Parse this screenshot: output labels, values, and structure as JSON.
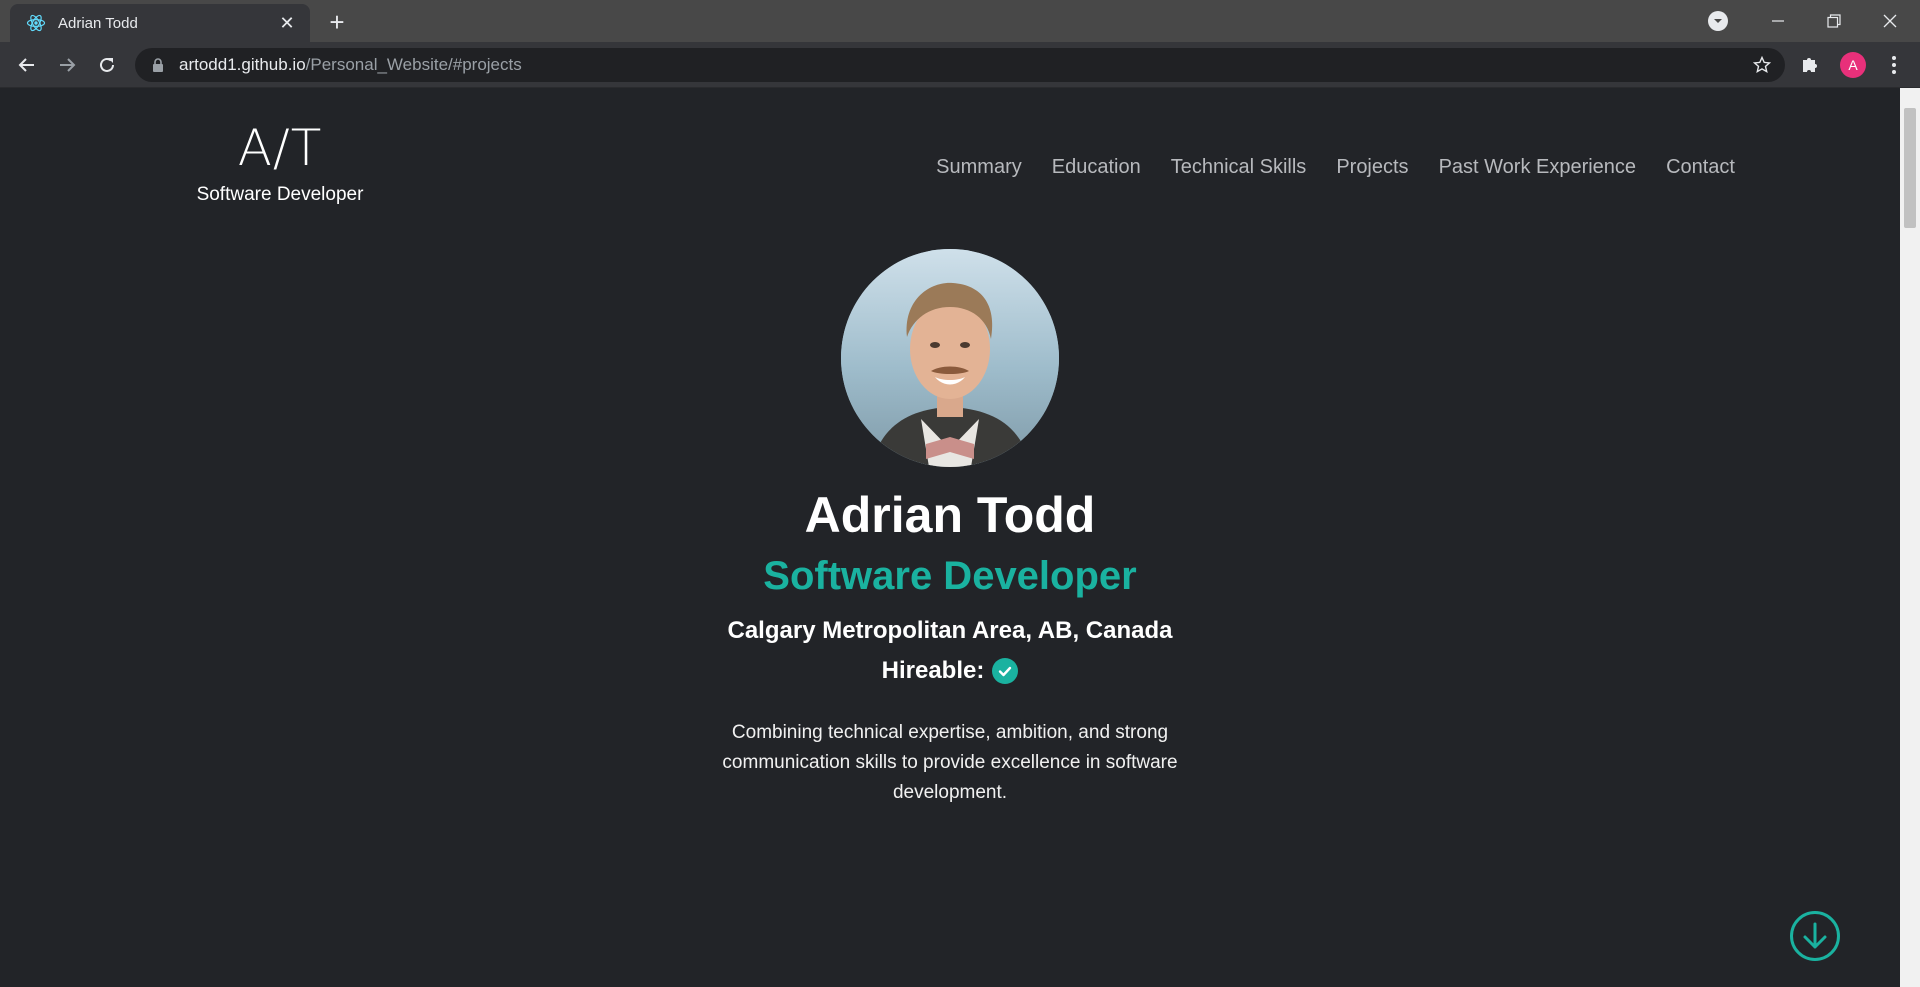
{
  "browser": {
    "tab_title": "Adrian Todd",
    "url_host": "artodd1.github.io",
    "url_path": "/Personal_Website/#projects",
    "profile_initial": "A"
  },
  "site": {
    "logo_mark": "A/T",
    "logo_subtitle": "Software Developer",
    "nav": [
      "Summary",
      "Education",
      "Technical Skills",
      "Projects",
      "Past Work Experience",
      "Contact"
    ]
  },
  "hero": {
    "name": "Adrian Todd",
    "role": "Software Developer",
    "location": "Calgary Metropolitan Area, AB, Canada",
    "hireable_label": "Hireable:",
    "hireable": true,
    "blurb": "Combining technical expertise, ambition, and strong communication skills to provide excellence in software development."
  },
  "colors": {
    "accent": "#1ab2a0",
    "background": "#222428",
    "avatar": "#e8307a"
  }
}
